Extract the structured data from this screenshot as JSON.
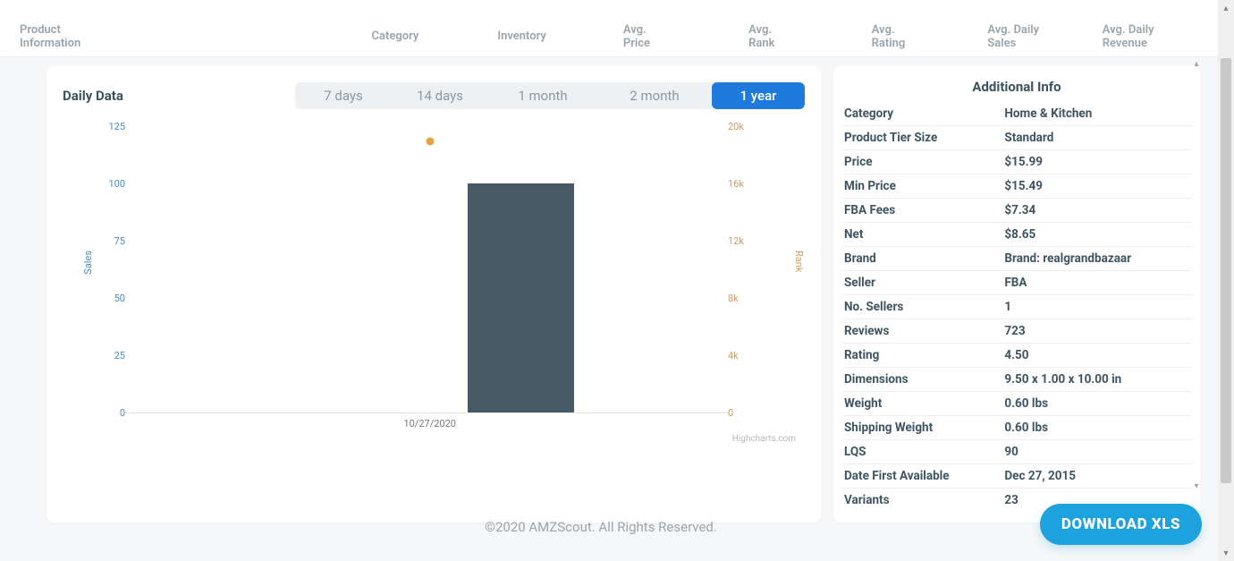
{
  "header": {
    "tabs": {
      "product_info": "Product Information",
      "category": "Category",
      "inventory": "Inventory",
      "avg_price": "Avg. Price",
      "avg_rank": "Avg. Rank",
      "avg_rating": "Avg. Rating",
      "avg_daily_sales": "Avg. Daily Sales",
      "avg_daily_revenue": "Avg. Daily Revenue"
    }
  },
  "daily": {
    "title": "Daily Data",
    "ranges": [
      "7 days",
      "14 days",
      "1 month",
      "2 month",
      "1 year"
    ],
    "active_index": 4
  },
  "chart_data": {
    "type": "bar",
    "categories": [
      "10/27/2020"
    ],
    "series": [
      {
        "name": "Sales",
        "axis": "left",
        "values": [
          100
        ]
      },
      {
        "name": "Rank",
        "axis": "right",
        "values": [
          19000
        ]
      }
    ],
    "left_axis": {
      "label": "Sales",
      "ticks": [
        0,
        25,
        50,
        75,
        100,
        125
      ],
      "min": 0,
      "max": 125
    },
    "right_axis": {
      "label": "Rank",
      "ticks": [
        "0",
        "4k",
        "8k",
        "12k",
        "16k",
        "20k"
      ],
      "min": 0,
      "max": 20000
    },
    "credit": "Highcharts.com"
  },
  "info": {
    "title": "Additional Info",
    "rows": [
      {
        "k": "Category",
        "v": "Home & Kitchen"
      },
      {
        "k": "Product Tier Size",
        "v": "Standard"
      },
      {
        "k": "Price",
        "v": "$15.99"
      },
      {
        "k": "Min Price",
        "v": "$15.49"
      },
      {
        "k": "FBA Fees",
        "v": "$7.34"
      },
      {
        "k": "Net",
        "v": "$8.65"
      },
      {
        "k": "Brand",
        "v": "Brand: realgrandbazaar"
      },
      {
        "k": "Seller",
        "v": "FBA"
      },
      {
        "k": "No. Sellers",
        "v": "1"
      },
      {
        "k": "Reviews",
        "v": "723"
      },
      {
        "k": "Rating",
        "v": "4.50"
      },
      {
        "k": "Dimensions",
        "v": "9.50 x 1.00 x 10.00 in"
      },
      {
        "k": "Weight",
        "v": "0.60 lbs"
      },
      {
        "k": "Shipping Weight",
        "v": "0.60 lbs"
      },
      {
        "k": "LQS",
        "v": "90"
      },
      {
        "k": "Date First Available",
        "v": "Dec 27, 2015"
      },
      {
        "k": "Variants",
        "v": "23"
      }
    ]
  },
  "footer": {
    "copyright": "©2020 AMZScout. All Rights Reserved.",
    "download_label": "DOWNLOAD XLS"
  }
}
